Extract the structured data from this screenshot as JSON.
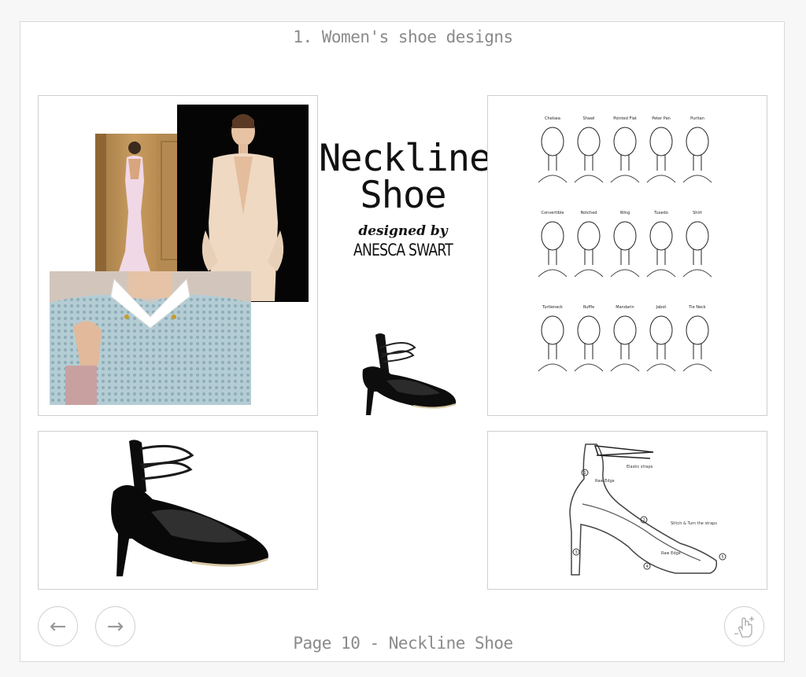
{
  "section": {
    "title": "1. Women's shoe designs"
  },
  "title_block": {
    "line1": "Neckline",
    "line2": "Shoe",
    "designed_by": "designed by",
    "designer": "ANESCA SWART"
  },
  "neckline_chart": {
    "rows": [
      [
        "Chelsea",
        "Shawl",
        "Pointed Flat",
        "Peter Pan",
        "Puritan"
      ],
      [
        "Convertible",
        "Notched",
        "Wing",
        "Tuxedo",
        "Shirt"
      ],
      [
        "Turtleneck",
        "Ruffle",
        "Mandarin",
        "Jabot",
        "Tie Neck"
      ]
    ]
  },
  "tech_drawing": {
    "labels": [
      "Elastic straps",
      "Raw Edge",
      "Stitch & Turn the straps",
      "Raw Edge"
    ],
    "markers": [
      "1",
      "2",
      "3",
      "4",
      "5"
    ]
  },
  "footer": {
    "page_label": "Page 10 - Neckline Shoe"
  },
  "nav": {
    "prev_icon": "←",
    "next_icon": "→",
    "zoom_icon": "pinch-zoom-icon"
  },
  "colors": {
    "background": "#f7f7f7",
    "border": "#cfcfcf",
    "text": "#8a8a8a"
  }
}
